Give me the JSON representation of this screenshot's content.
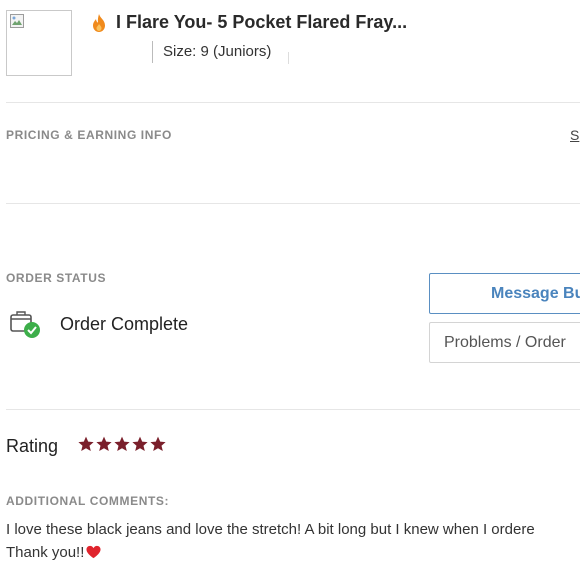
{
  "product": {
    "title": "I Flare You- 5 Pocket Flared Fray...",
    "size": "Size: 9 (Juniors)"
  },
  "pricing": {
    "label": "PRICING & EARNING INFO",
    "link_text": "S"
  },
  "order_status": {
    "label": "ORDER STATUS",
    "status": "Order Complete",
    "message_button": "Message Bu",
    "problems_button": "Problems / Order"
  },
  "rating": {
    "label": "Rating",
    "stars": 5,
    "star_color": "#7a1f2b"
  },
  "comments": {
    "label": "ADDITIONAL COMMENTS:",
    "line1": "I love these black jeans and love the stretch! A bit long but I knew when I ordere",
    "line2": "Thank you!!"
  },
  "colors": {
    "link_blue": "#4a84bd",
    "success_green": "#3dae4a",
    "flame_orange": "#f08a1c",
    "heart_red": "#e0242d"
  }
}
